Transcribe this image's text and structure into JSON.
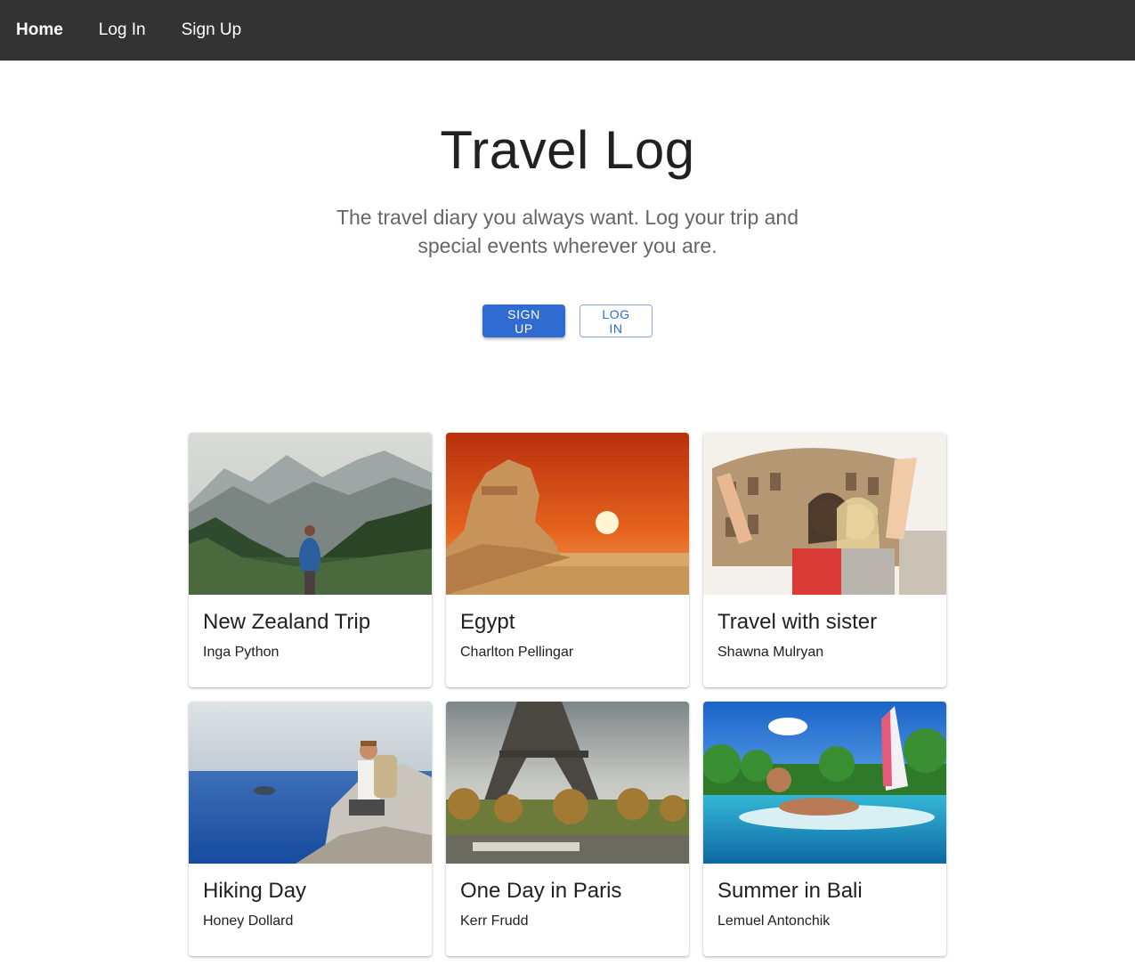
{
  "nav": {
    "home": "Home",
    "login": "Log In",
    "signup": "Sign Up"
  },
  "hero": {
    "title": "Travel Log",
    "subtitle": "The travel diary you always want. Log your trip and special events wherever you are.",
    "signup_button": "SIGN UP",
    "login_button": "LOG IN"
  },
  "colors": {
    "navbar": "#333333",
    "primary": "#2f6bd1"
  },
  "cards": [
    {
      "title": "New Zealand Trip",
      "author": "Inga Python",
      "image": "mountain-valley-hiker-photo"
    },
    {
      "title": "Egypt",
      "author": "Charlton Pellingar",
      "image": "sphinx-sunset-photo"
    },
    {
      "title": "Travel with sister",
      "author": "Shawna Mulryan",
      "image": "colosseum-selfie-photo"
    },
    {
      "title": "Hiking Day",
      "author": "Honey Dollard",
      "image": "coastal-hiker-photo"
    },
    {
      "title": "One Day in Paris",
      "author": "Kerr Frudd",
      "image": "eiffel-tower-photo"
    },
    {
      "title": "Summer in Bali",
      "author": "Lemuel Antonchik",
      "image": "bali-surfboard-photo"
    }
  ]
}
